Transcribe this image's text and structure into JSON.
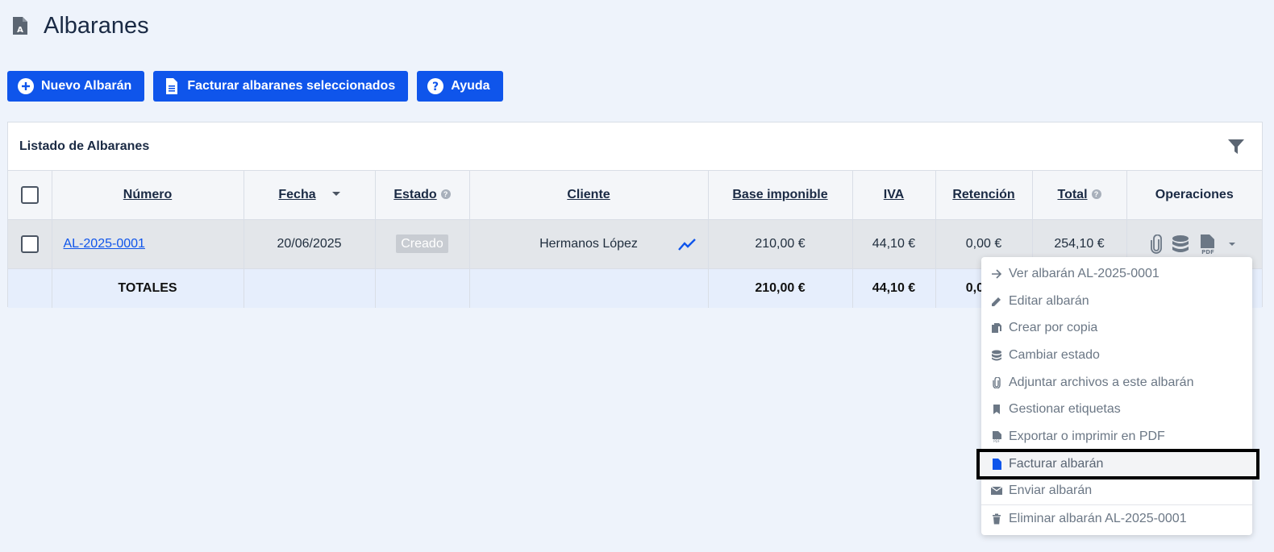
{
  "page": {
    "title": "Albaranes"
  },
  "toolbar": {
    "new_label": "Nuevo Albarán",
    "invoice_selected_label": "Facturar albaranes seleccionados",
    "help_label": "Ayuda"
  },
  "panel": {
    "title": "Listado de Albaranes"
  },
  "table": {
    "headers": {
      "numero": "Número",
      "fecha": "Fecha",
      "estado": "Estado",
      "cliente": "Cliente",
      "base": "Base imponible",
      "iva": "IVA",
      "retencion": "Retención",
      "total": "Total",
      "operaciones": "Operaciones"
    },
    "rows": [
      {
        "numero": "AL-2025-0001",
        "fecha": "20/06/2025",
        "estado": "Creado",
        "cliente": "Hermanos López",
        "base": "210,00 €",
        "iva": "44,10 €",
        "retencion": "0,00 €",
        "total": "254,10 €"
      }
    ],
    "totals": {
      "label": "TOTALES",
      "base": "210,00 €",
      "iva": "44,10 €",
      "retencion": "0,00 €"
    }
  },
  "menu": {
    "items": [
      {
        "label": "Ver albarán AL-2025-0001",
        "icon": "arrow-right-icon"
      },
      {
        "label": "Editar albarán",
        "icon": "pencil-icon"
      },
      {
        "label": "Crear por copia",
        "icon": "copy-icon"
      },
      {
        "label": "Cambiar estado",
        "icon": "database-icon"
      },
      {
        "label": "Adjuntar archivos a este albarán",
        "icon": "paperclip-icon"
      },
      {
        "label": "Gestionar etiquetas",
        "icon": "bookmark-icon"
      },
      {
        "label": "Exportar o imprimir en PDF",
        "icon": "pdf-icon"
      },
      {
        "label": "Facturar albarán",
        "icon": "invoice-icon",
        "highlighted": true
      },
      {
        "label": "Enviar albarán",
        "icon": "envelope-icon"
      },
      {
        "label": "Eliminar albarán AL-2025-0001",
        "icon": "trash-icon"
      }
    ]
  },
  "colors": {
    "primary": "#0f55eb",
    "background": "#eef3fb",
    "row_selected": "#e3e6ea",
    "totals_row": "#e6eefc",
    "menu_text": "#6b7785"
  }
}
